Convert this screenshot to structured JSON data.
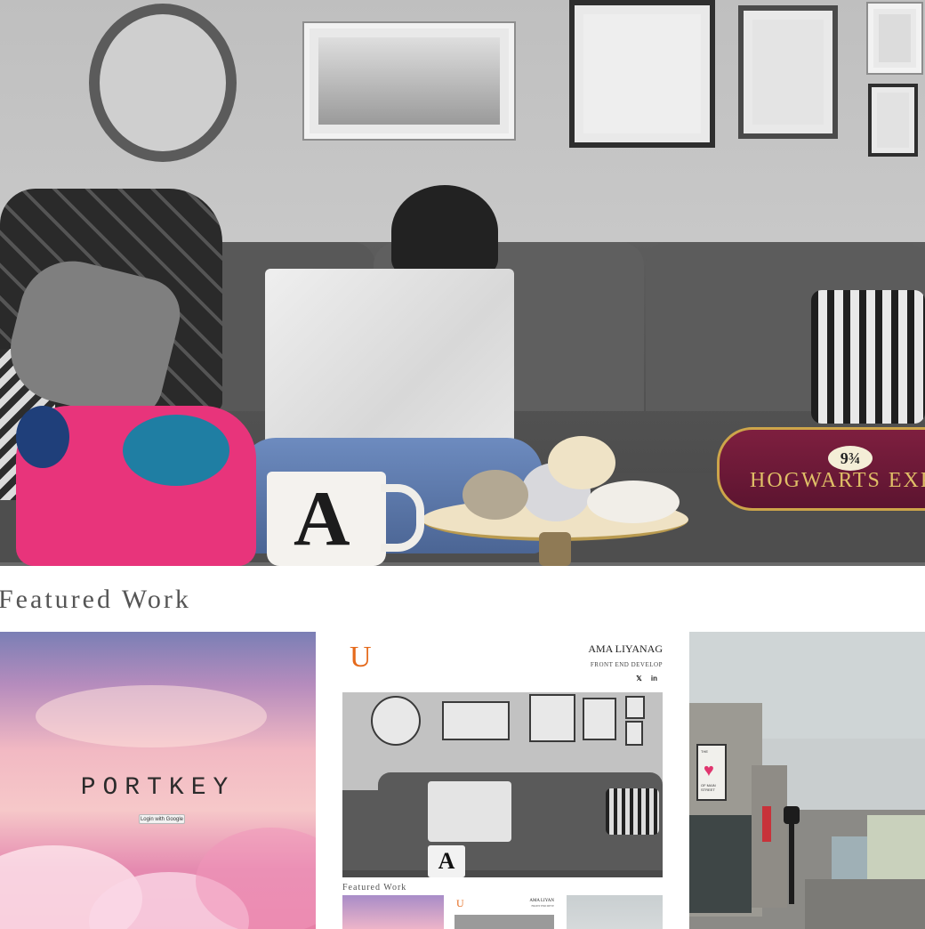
{
  "featured": {
    "title": "Featured Work"
  },
  "cards": {
    "portkey": {
      "title": "PORTKEY",
      "login_label": "Login with Google"
    },
    "site": {
      "logo": "U",
      "name": "AMA LIYANAG",
      "role": "FRONT END DEVELOP",
      "social": [
        "twitter-icon",
        "linkedin-icon"
      ],
      "mug_letter": "A",
      "featured_label": "Featured Work",
      "mini_logo": "U",
      "mini_name": "AMA LIYAN",
      "mini_role": "FRONT END DEVE"
    },
    "street": {
      "sign_top": "THE",
      "sign_bottom": "OF MAIN STREET"
    }
  },
  "hero": {
    "mug_letter": "A",
    "pillow_text": "HOGWARTS EXPR",
    "pillow_badge": "9¾"
  },
  "colors": {
    "accent": "#e56a1c",
    "sock_pink": "#e8347b",
    "pillow_maroon": "#7e1f3f",
    "heading_grey": "#555555"
  }
}
